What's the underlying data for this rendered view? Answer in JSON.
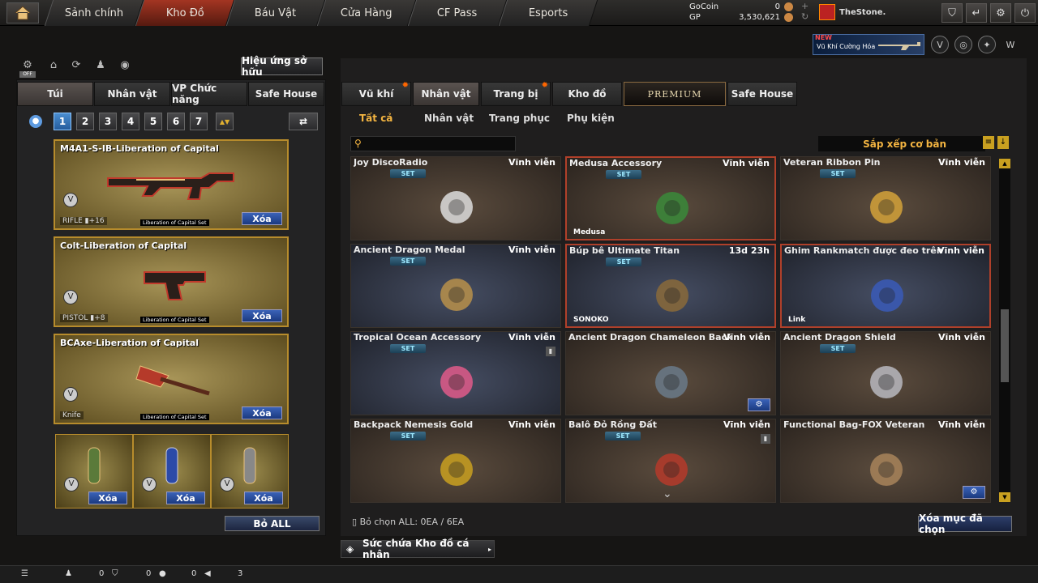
{
  "nav": {
    "tabs": [
      "Sảnh chính",
      "Kho Đồ",
      "Báu Vật",
      "Cửa Hàng",
      "CF Pass",
      "Esports"
    ]
  },
  "currency": {
    "gocoin_label": "GoCoin",
    "gocoin_value": "0",
    "gp_label": "GP",
    "gp_value": "3,530,621"
  },
  "user": {
    "name": "TheStone."
  },
  "promo": {
    "new": "NEW",
    "text": "Vũ Khí Cường Hóa"
  },
  "left": {
    "effects_btn": "Hiệu ứng sở hữu",
    "off_label": "OFF",
    "tabs": [
      "Túi",
      "Nhân vật",
      "VP Chức năng",
      "Safe House"
    ],
    "pages": [
      "1",
      "2",
      "3",
      "4",
      "5",
      "6",
      "7"
    ],
    "weapons": [
      {
        "name": "M4A1-S-IB-Liberation of Capital",
        "type": "RIFLE",
        "bonus": "▮+16",
        "set": "Liberation of Capital Set",
        "delete": "Xóa"
      },
      {
        "name": "Colt-Liberation of Capital",
        "type": "PISTOL",
        "bonus": "▮+8",
        "set": "Liberation of Capital Set",
        "delete": "Xóa"
      },
      {
        "name": "BCAxe-Liberation of Capital",
        "type": "Knife",
        "bonus": "",
        "set": "Liberation of Capital Set",
        "delete": "Xóa"
      }
    ],
    "small_slots": [
      {
        "delete": "Xóa"
      },
      {
        "delete": "Xóa"
      },
      {
        "delete": "Xóa"
      }
    ],
    "remove_all": "Bỏ ALL"
  },
  "right": {
    "tabs": [
      "Vũ khí",
      "Nhân vật",
      "Trang bị",
      "Kho đồ",
      "PREMIUM",
      "Safe House"
    ],
    "subtabs": [
      "Tất cả",
      "Nhân vật",
      "Trang phục",
      "Phụ kiện"
    ],
    "sort_label": "Sắp xếp cơ bản",
    "items": [
      {
        "name": "Joy DiscoRadio",
        "duration": "Vĩnh viễn",
        "set": "SET",
        "tag": "",
        "color": "brown",
        "selected": false
      },
      {
        "name": "Medusa Accessory",
        "duration": "Vĩnh viễn",
        "set": "SET",
        "tag": "Medusa",
        "color": "brown",
        "selected": true
      },
      {
        "name": "Veteran Ribbon Pin",
        "duration": "Vĩnh viễn",
        "set": "SET",
        "tag": "",
        "color": "brown",
        "selected": false
      },
      {
        "name": "Ancient Dragon Medal",
        "duration": "Vĩnh viễn",
        "set": "SET",
        "tag": "",
        "color": "blue",
        "selected": false
      },
      {
        "name": "Búp bê Ultimate Titan",
        "duration": "13d 23h",
        "set": "SET",
        "tag": "SONOKO",
        "color": "blue",
        "selected": true
      },
      {
        "name": "Ghim Rankmatch được đeo trên",
        "duration": "Vĩnh viễn",
        "set": "",
        "tag": "Link",
        "color": "blue",
        "selected": true
      },
      {
        "name": "Tropical Ocean Accessory",
        "duration": "Vĩnh viễn",
        "set": "SET",
        "tag": "",
        "color": "blue",
        "selected": false
      },
      {
        "name": "Ancient Dragon Chameleon Backpack",
        "duration": "Vĩnh viễn",
        "set": "",
        "tag": "",
        "color": "brown",
        "selected": false
      },
      {
        "name": "Ancient Dragon Shield",
        "duration": "Vĩnh viễn",
        "set": "SET",
        "tag": "",
        "color": "brown",
        "selected": false
      },
      {
        "name": "Backpack Nemesis Gold",
        "duration": "Vĩnh viễn",
        "set": "SET",
        "tag": "",
        "color": "brown",
        "selected": false
      },
      {
        "name": "Balô Đỏ Rồng Đất",
        "duration": "Vĩnh viễn",
        "set": "SET",
        "tag": "",
        "color": "brown",
        "selected": false
      },
      {
        "name": "Functional Bag-FOX Veteran",
        "duration": "Vĩnh viễn",
        "set": "",
        "tag": "",
        "color": "brown",
        "selected": false
      }
    ],
    "deselect_all": "Bỏ chọn ALL: 0EA / 6EA",
    "delete_selected": "Xóa mục đã chọn",
    "capacity": "Sức chứa Kho đồ cá nhân"
  },
  "bottom": {
    "count1": "0",
    "count2": "0",
    "count3": "3"
  }
}
